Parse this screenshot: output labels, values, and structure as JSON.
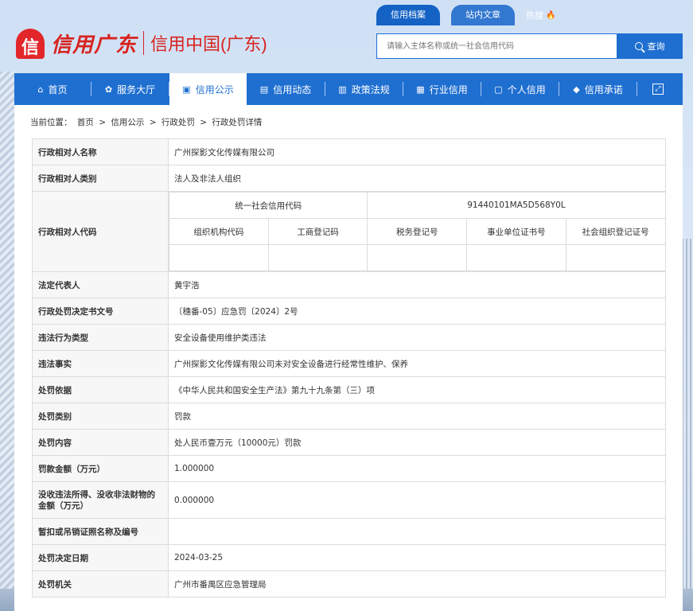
{
  "header": {
    "logo_script": "信用广东",
    "logo_text": "信用中国(广东)",
    "top_tabs": [
      "信用档案",
      "站内文章"
    ],
    "hot_search": "热搜",
    "search_placeholder": "请输入主体名称或统一社会信用代码",
    "search_button": "查询"
  },
  "nav": {
    "items": [
      "首页",
      "服务大厅",
      "信用公示",
      "信用动态",
      "政策法规",
      "行业信用",
      "个人信用",
      "信用承诺"
    ],
    "active_index": 2
  },
  "breadcrumb": {
    "label": "当前位置：",
    "items": [
      "首页",
      "信用公示",
      "行政处罚",
      "行政处罚详情"
    ],
    "separator": ">"
  },
  "record": {
    "name_label": "行政相对人名称",
    "name": "广州探影文化传媒有限公司",
    "type_label": "行政相对人类别",
    "type": "法人及非法人组织",
    "code_label": "行政相对人代码",
    "credit_code_label": "统一社会信用代码",
    "credit_code": "91440101MA5D568Y0L",
    "sub_headers": [
      "组织机构代码",
      "工商登记码",
      "税务登记号",
      "事业单位证书号",
      "社会组织登记证号"
    ],
    "sub_values": [
      "",
      "",
      "",
      "",
      ""
    ],
    "rows": [
      {
        "label": "法定代表人",
        "value": "黄宇浩"
      },
      {
        "label": "行政处罚决定书文号",
        "value": "〔穗番-05〕应急罚〔2024〕2号"
      },
      {
        "label": "违法行为类型",
        "value": "安全设备使用维护类违法"
      },
      {
        "label": "违法事实",
        "value": "广州探影文化传媒有限公司未对安全设备进行经常性维护、保养"
      },
      {
        "label": "处罚依据",
        "value": "《中华人民共和国安全生产法》第九十九条第（三）项"
      },
      {
        "label": "处罚类别",
        "value": "罚款"
      },
      {
        "label": "处罚内容",
        "value": "处人民币壹万元（10000元）罚款"
      },
      {
        "label": "罚款金额（万元）",
        "value": "1.000000"
      },
      {
        "label": "没收违法所得、没收非法财物的金额（万元）",
        "value": "0.000000"
      },
      {
        "label": "暂扣或吊销证照名称及编号",
        "value": ""
      },
      {
        "label": "处罚决定日期",
        "value": "2024-03-25"
      },
      {
        "label": "处罚机关",
        "value": "广州市番禺区应急管理局"
      }
    ]
  }
}
